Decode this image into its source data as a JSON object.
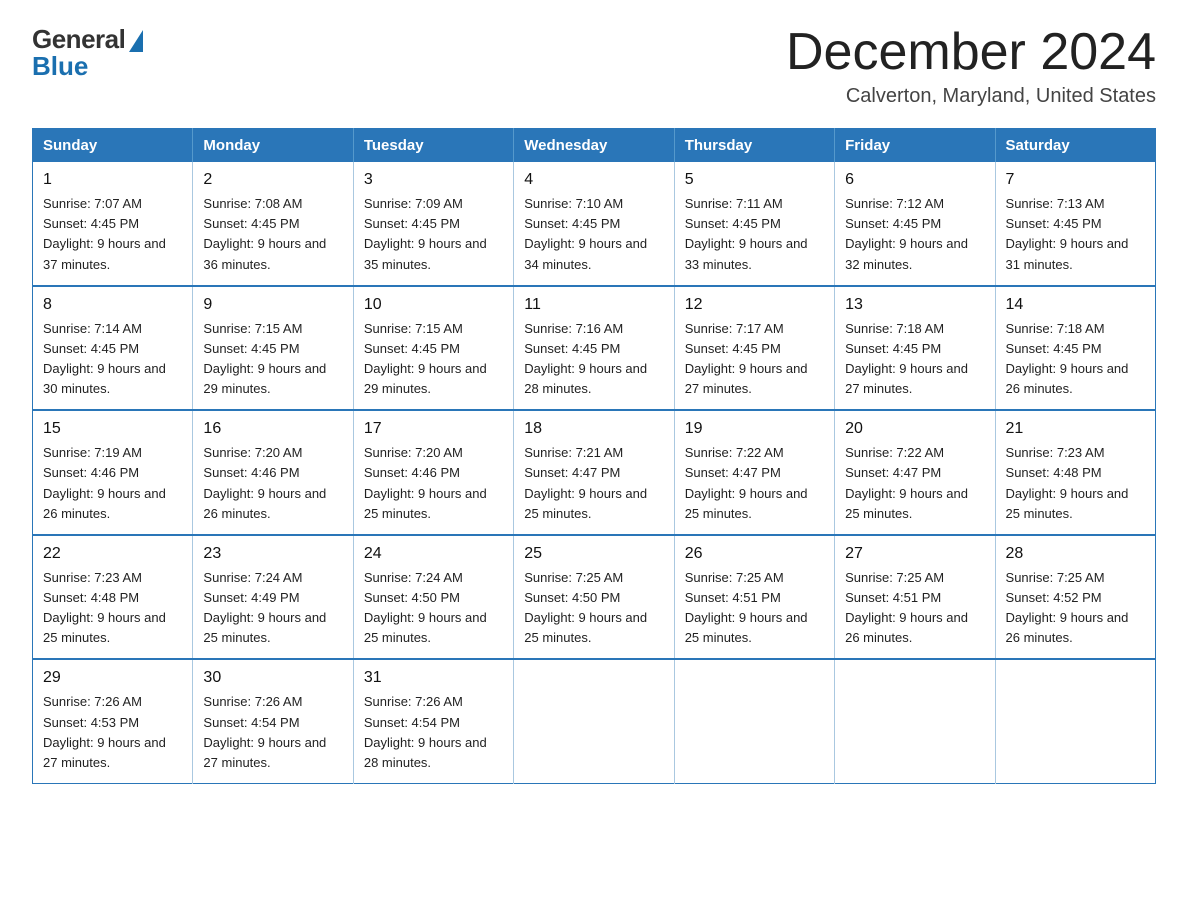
{
  "logo": {
    "general": "General",
    "blue": "Blue"
  },
  "header": {
    "month_title": "December 2024",
    "location": "Calverton, Maryland, United States"
  },
  "weekdays": [
    "Sunday",
    "Monday",
    "Tuesday",
    "Wednesday",
    "Thursday",
    "Friday",
    "Saturday"
  ],
  "weeks": [
    [
      {
        "day": "1",
        "sunrise": "Sunrise: 7:07 AM",
        "sunset": "Sunset: 4:45 PM",
        "daylight": "Daylight: 9 hours and 37 minutes."
      },
      {
        "day": "2",
        "sunrise": "Sunrise: 7:08 AM",
        "sunset": "Sunset: 4:45 PM",
        "daylight": "Daylight: 9 hours and 36 minutes."
      },
      {
        "day": "3",
        "sunrise": "Sunrise: 7:09 AM",
        "sunset": "Sunset: 4:45 PM",
        "daylight": "Daylight: 9 hours and 35 minutes."
      },
      {
        "day": "4",
        "sunrise": "Sunrise: 7:10 AM",
        "sunset": "Sunset: 4:45 PM",
        "daylight": "Daylight: 9 hours and 34 minutes."
      },
      {
        "day": "5",
        "sunrise": "Sunrise: 7:11 AM",
        "sunset": "Sunset: 4:45 PM",
        "daylight": "Daylight: 9 hours and 33 minutes."
      },
      {
        "day": "6",
        "sunrise": "Sunrise: 7:12 AM",
        "sunset": "Sunset: 4:45 PM",
        "daylight": "Daylight: 9 hours and 32 minutes."
      },
      {
        "day": "7",
        "sunrise": "Sunrise: 7:13 AM",
        "sunset": "Sunset: 4:45 PM",
        "daylight": "Daylight: 9 hours and 31 minutes."
      }
    ],
    [
      {
        "day": "8",
        "sunrise": "Sunrise: 7:14 AM",
        "sunset": "Sunset: 4:45 PM",
        "daylight": "Daylight: 9 hours and 30 minutes."
      },
      {
        "day": "9",
        "sunrise": "Sunrise: 7:15 AM",
        "sunset": "Sunset: 4:45 PM",
        "daylight": "Daylight: 9 hours and 29 minutes."
      },
      {
        "day": "10",
        "sunrise": "Sunrise: 7:15 AM",
        "sunset": "Sunset: 4:45 PM",
        "daylight": "Daylight: 9 hours and 29 minutes."
      },
      {
        "day": "11",
        "sunrise": "Sunrise: 7:16 AM",
        "sunset": "Sunset: 4:45 PM",
        "daylight": "Daylight: 9 hours and 28 minutes."
      },
      {
        "day": "12",
        "sunrise": "Sunrise: 7:17 AM",
        "sunset": "Sunset: 4:45 PM",
        "daylight": "Daylight: 9 hours and 27 minutes."
      },
      {
        "day": "13",
        "sunrise": "Sunrise: 7:18 AM",
        "sunset": "Sunset: 4:45 PM",
        "daylight": "Daylight: 9 hours and 27 minutes."
      },
      {
        "day": "14",
        "sunrise": "Sunrise: 7:18 AM",
        "sunset": "Sunset: 4:45 PM",
        "daylight": "Daylight: 9 hours and 26 minutes."
      }
    ],
    [
      {
        "day": "15",
        "sunrise": "Sunrise: 7:19 AM",
        "sunset": "Sunset: 4:46 PM",
        "daylight": "Daylight: 9 hours and 26 minutes."
      },
      {
        "day": "16",
        "sunrise": "Sunrise: 7:20 AM",
        "sunset": "Sunset: 4:46 PM",
        "daylight": "Daylight: 9 hours and 26 minutes."
      },
      {
        "day": "17",
        "sunrise": "Sunrise: 7:20 AM",
        "sunset": "Sunset: 4:46 PM",
        "daylight": "Daylight: 9 hours and 25 minutes."
      },
      {
        "day": "18",
        "sunrise": "Sunrise: 7:21 AM",
        "sunset": "Sunset: 4:47 PM",
        "daylight": "Daylight: 9 hours and 25 minutes."
      },
      {
        "day": "19",
        "sunrise": "Sunrise: 7:22 AM",
        "sunset": "Sunset: 4:47 PM",
        "daylight": "Daylight: 9 hours and 25 minutes."
      },
      {
        "day": "20",
        "sunrise": "Sunrise: 7:22 AM",
        "sunset": "Sunset: 4:47 PM",
        "daylight": "Daylight: 9 hours and 25 minutes."
      },
      {
        "day": "21",
        "sunrise": "Sunrise: 7:23 AM",
        "sunset": "Sunset: 4:48 PM",
        "daylight": "Daylight: 9 hours and 25 minutes."
      }
    ],
    [
      {
        "day": "22",
        "sunrise": "Sunrise: 7:23 AM",
        "sunset": "Sunset: 4:48 PM",
        "daylight": "Daylight: 9 hours and 25 minutes."
      },
      {
        "day": "23",
        "sunrise": "Sunrise: 7:24 AM",
        "sunset": "Sunset: 4:49 PM",
        "daylight": "Daylight: 9 hours and 25 minutes."
      },
      {
        "day": "24",
        "sunrise": "Sunrise: 7:24 AM",
        "sunset": "Sunset: 4:50 PM",
        "daylight": "Daylight: 9 hours and 25 minutes."
      },
      {
        "day": "25",
        "sunrise": "Sunrise: 7:25 AM",
        "sunset": "Sunset: 4:50 PM",
        "daylight": "Daylight: 9 hours and 25 minutes."
      },
      {
        "day": "26",
        "sunrise": "Sunrise: 7:25 AM",
        "sunset": "Sunset: 4:51 PM",
        "daylight": "Daylight: 9 hours and 25 minutes."
      },
      {
        "day": "27",
        "sunrise": "Sunrise: 7:25 AM",
        "sunset": "Sunset: 4:51 PM",
        "daylight": "Daylight: 9 hours and 26 minutes."
      },
      {
        "day": "28",
        "sunrise": "Sunrise: 7:25 AM",
        "sunset": "Sunset: 4:52 PM",
        "daylight": "Daylight: 9 hours and 26 minutes."
      }
    ],
    [
      {
        "day": "29",
        "sunrise": "Sunrise: 7:26 AM",
        "sunset": "Sunset: 4:53 PM",
        "daylight": "Daylight: 9 hours and 27 minutes."
      },
      {
        "day": "30",
        "sunrise": "Sunrise: 7:26 AM",
        "sunset": "Sunset: 4:54 PM",
        "daylight": "Daylight: 9 hours and 27 minutes."
      },
      {
        "day": "31",
        "sunrise": "Sunrise: 7:26 AM",
        "sunset": "Sunset: 4:54 PM",
        "daylight": "Daylight: 9 hours and 28 minutes."
      },
      null,
      null,
      null,
      null
    ]
  ]
}
